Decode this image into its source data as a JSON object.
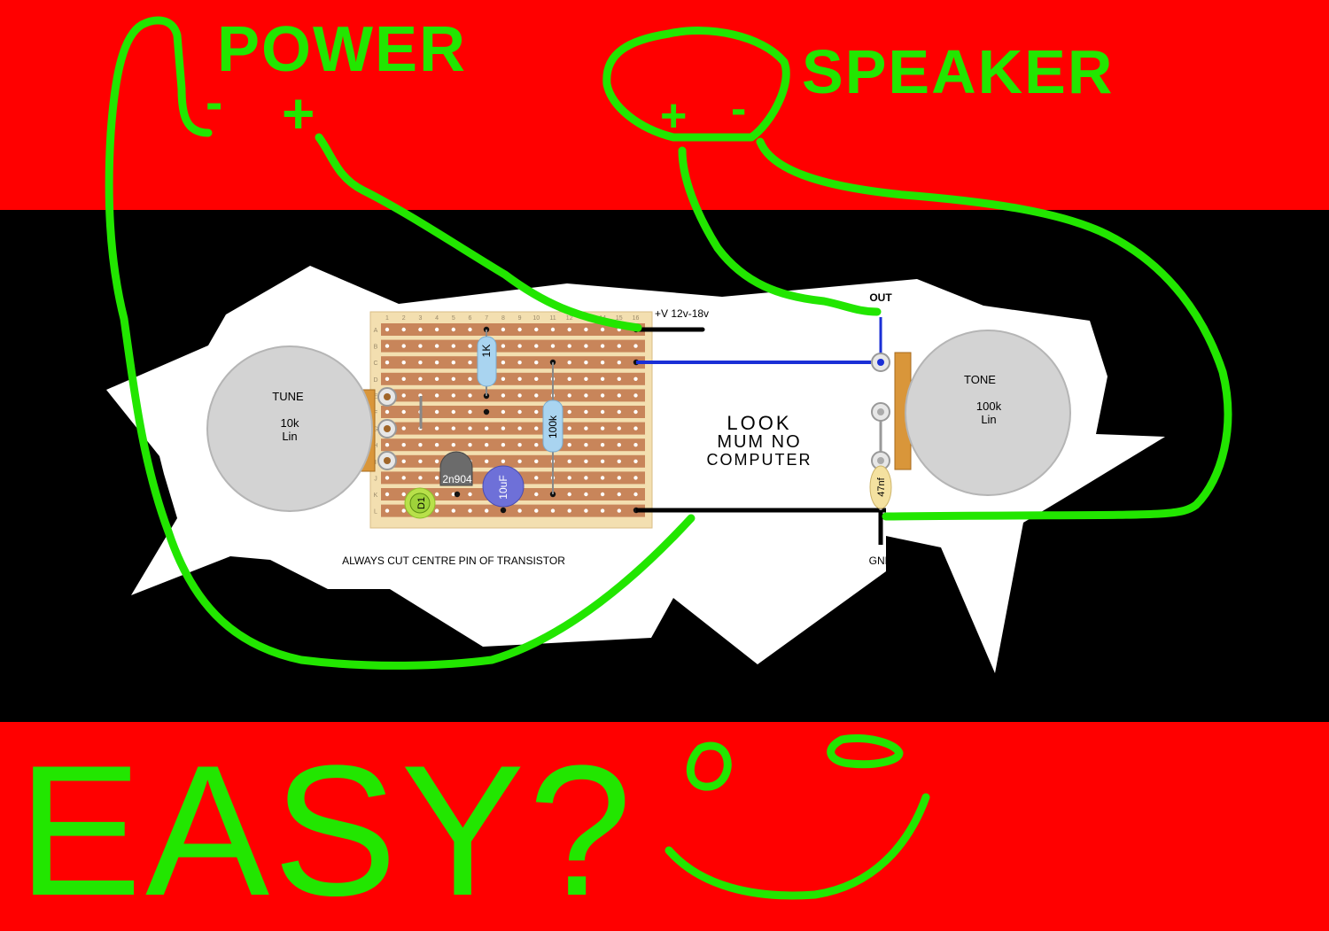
{
  "colors": {
    "red": "#ff0000",
    "black": "#000000",
    "green": "#22e600",
    "board": "#c8855a",
    "strip_bg": "#f3dfb0",
    "pot": "#d3d3d3",
    "blue_wire": "#1a2fd6"
  },
  "handwritten": {
    "power_title": "POWER",
    "power_minus": "-",
    "power_plus": "+",
    "speaker_title": "SPEAKER",
    "speaker_plus": "+",
    "speaker_minus": "-",
    "easy": "EASY?",
    "look_line1": "LOOK",
    "look_line2": "MUM NO",
    "look_line3": "COMPUTER"
  },
  "labels": {
    "supply": "+V 12v-18v",
    "out": "OUT",
    "gnd": "GND",
    "note": "ALWAYS CUT CENTRE PIN OF TRANSISTOR"
  },
  "pots": [
    {
      "name": "TUNE",
      "value": "10k",
      "taper": "Lin"
    },
    {
      "name": "TONE",
      "value": "100k",
      "taper": "Lin"
    }
  ],
  "components": {
    "r1": "1K",
    "r2": "100k",
    "transistor": "2n904",
    "cap_electrolytic": "10uF",
    "cap_ceramic": "47nf",
    "diode": "D1"
  },
  "board": {
    "columns": [
      "1",
      "2",
      "3",
      "4",
      "5",
      "6",
      "7",
      "8",
      "9",
      "10",
      "11",
      "12",
      "13",
      "14",
      "15",
      "16"
    ],
    "rows": [
      "A",
      "B",
      "C",
      "D",
      "E",
      "F",
      "G",
      "H",
      "I",
      "J",
      "K",
      "L"
    ]
  }
}
